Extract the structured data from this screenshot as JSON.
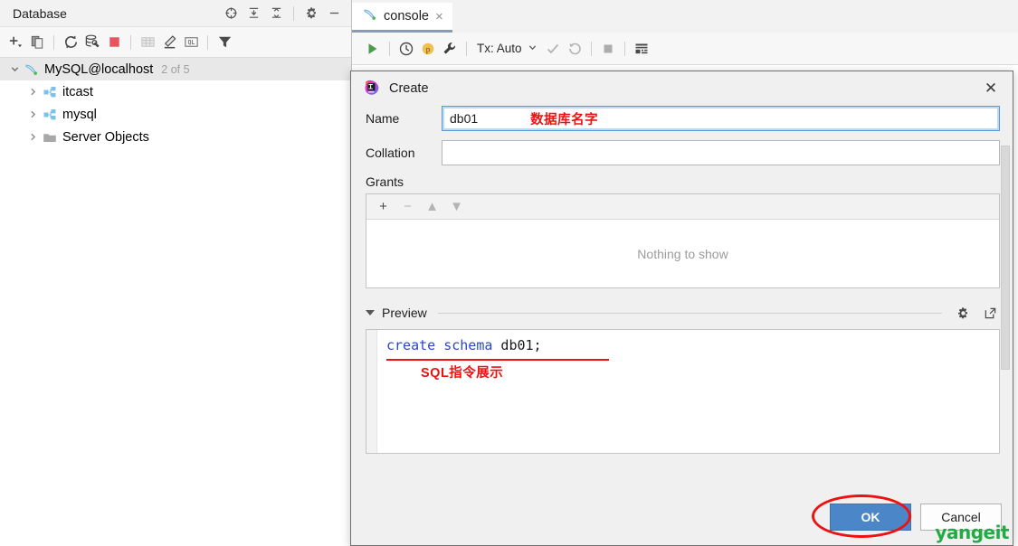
{
  "db_panel": {
    "title": "Database",
    "header_icons": [
      {
        "name": "locate-target-icon",
        "label": "Scroll from Source"
      },
      {
        "name": "expand-all-icon",
        "label": "Expand All"
      },
      {
        "name": "collapse-all-icon",
        "label": "Collapse All"
      },
      {
        "name": "gear-icon",
        "label": "Options"
      },
      {
        "name": "minimize-icon",
        "label": "Hide"
      }
    ],
    "toolbar_icons": [
      {
        "name": "add-dropdown-icon",
        "label": "New"
      },
      {
        "name": "copy-icon",
        "label": "Duplicate"
      },
      {
        "name": "refresh-icon",
        "label": "Refresh"
      },
      {
        "name": "database-settings-icon",
        "label": "Data Source Properties"
      },
      {
        "name": "stop-icon",
        "label": "Stop"
      },
      {
        "name": "table-icon",
        "label": "Data Editor"
      },
      {
        "name": "edit-icon",
        "label": "Modify"
      },
      {
        "name": "ql-icon",
        "label": "Jump to Query Console"
      },
      {
        "name": "filter-icon",
        "label": "Filter"
      }
    ],
    "tree": [
      {
        "label": "MySQL@localhost",
        "count": "2 of 5",
        "icon": "mysql-dolphin-icon",
        "expanded": true,
        "selected": true,
        "indent": 0
      },
      {
        "label": "itcast",
        "count": "",
        "icon": "schema-icon",
        "expanded": false,
        "selected": false,
        "indent": 1
      },
      {
        "label": "mysql",
        "count": "",
        "icon": "schema-icon",
        "expanded": false,
        "selected": false,
        "indent": 1
      },
      {
        "label": "Server Objects",
        "count": "",
        "icon": "folder-icon",
        "expanded": false,
        "selected": false,
        "indent": 1
      }
    ]
  },
  "editor": {
    "tab": {
      "label": "console",
      "icon": "mysql-dolphin-icon",
      "close": "×"
    },
    "toolbar": {
      "run_label": "Execute",
      "tx_label": "Tx: Auto",
      "icons": [
        {
          "name": "run-icon",
          "label": "Execute"
        },
        {
          "name": "history-clock-icon",
          "label": "History"
        },
        {
          "name": "parameters-icon",
          "label": "Parameters"
        },
        {
          "name": "wrench-icon",
          "label": "Session Settings"
        },
        {
          "name": "commit-check-icon",
          "label": "Commit"
        },
        {
          "name": "rollback-icon",
          "label": "Rollback"
        },
        {
          "name": "stop-square-icon",
          "label": "Stop"
        },
        {
          "name": "grid-output-icon",
          "label": "Output Options"
        }
      ]
    }
  },
  "dialog": {
    "title": "Create",
    "app_icon": "intellij-idea-icon",
    "close_label": "✕",
    "fields": {
      "name_label": "Name",
      "name_value": "db01",
      "name_annotation": "数据库名字",
      "collation_label": "Collation",
      "collation_value": ""
    },
    "grants": {
      "label": "Grants",
      "empty_text": "Nothing to show",
      "toolbar": [
        {
          "name": "add-grant-icon",
          "glyph": "+",
          "disabled": false
        },
        {
          "name": "remove-grant-icon",
          "glyph": "−",
          "disabled": true
        },
        {
          "name": "move-up-icon",
          "glyph": "▲",
          "disabled": true
        },
        {
          "name": "move-down-icon",
          "glyph": "▼",
          "disabled": true
        }
      ]
    },
    "preview": {
      "label": "Preview",
      "sql_keywords": "create schema",
      "sql_identifier": " db01;",
      "annotation": "SQL指令展示",
      "gear_icon": "gear-icon",
      "popout_icon": "open-in-new-window-icon"
    },
    "footer": {
      "ok_label": "OK",
      "cancel_label": "Cancel"
    }
  },
  "watermark": {
    "text": "yangeit",
    "color": "#22aa44"
  },
  "colors": {
    "accent_blue": "#4a86c8",
    "annotation_red": "#ee1111",
    "sql_keyword_blue": "#2b45cc",
    "tab_underline": "#8a9bb5",
    "schema_icon_blue": "#7ec0e8"
  }
}
